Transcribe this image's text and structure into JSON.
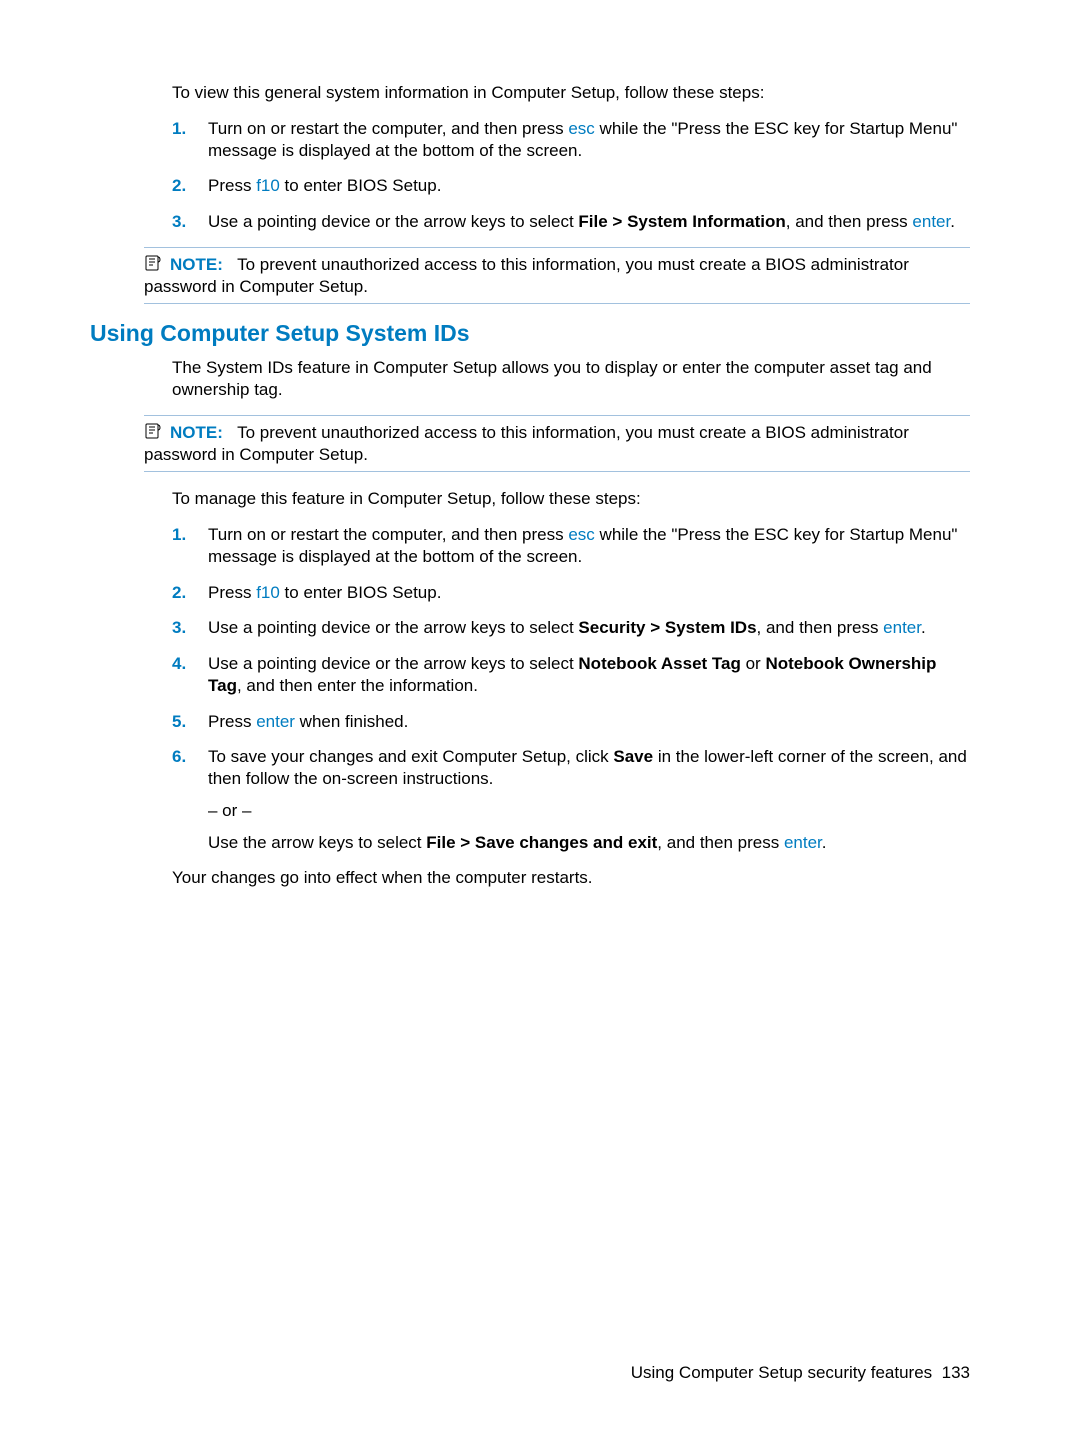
{
  "intro1": "To view this general system information in Computer Setup, follow these steps:",
  "steps1": {
    "s1a": "Turn on or restart the computer, and then press ",
    "s1b_key": "esc",
    "s1c": " while the \"Press the ESC key for Startup Menu\" message is displayed at the bottom of the screen.",
    "s2a": "Press ",
    "s2b_key": "f10",
    "s2c": " to enter BIOS Setup.",
    "s3a": "Use a pointing device or the arrow keys to select ",
    "s3b_bold": "File > System Information",
    "s3c": ", and then press ",
    "s3d_key": "enter",
    "s3e": "."
  },
  "note1": {
    "label": "NOTE:",
    "text": "To prevent unauthorized access to this information, you must create a BIOS administrator password in Computer Setup."
  },
  "heading2": "Using Computer Setup System IDs",
  "para2a": "The System IDs feature in Computer Setup allows you to display or enter the computer asset tag and ownership tag.",
  "note2": {
    "label": "NOTE:",
    "text": "To prevent unauthorized access to this information, you must create a BIOS administrator password in Computer Setup."
  },
  "para2b": "To manage this feature in Computer Setup, follow these steps:",
  "steps2": {
    "s1a": "Turn on or restart the computer, and then press ",
    "s1b_key": "esc",
    "s1c": " while the \"Press the ESC key for Startup Menu\" message is displayed at the bottom of the screen.",
    "s2a": "Press ",
    "s2b_key": "f10",
    "s2c": " to enter BIOS Setup.",
    "s3a": "Use a pointing device or the arrow keys to select ",
    "s3b_bold": "Security > System IDs",
    "s3c": ", and then press ",
    "s3d_key": "enter",
    "s3e": ".",
    "s4a": "Use a pointing device or the arrow keys to select ",
    "s4b_bold": "Notebook Asset Tag",
    "s4c": " or ",
    "s4d_bold": "Notebook Ownership Tag",
    "s4e": ", and then enter the information.",
    "s5a": "Press ",
    "s5b_key": "enter",
    "s5c": " when finished.",
    "s6a": "To save your changes and exit Computer Setup, click ",
    "s6b_bold": "Save",
    "s6c": " in the lower-left corner of the screen, and then follow the on-screen instructions.",
    "or": "– or –",
    "s6d": "Use the arrow keys to select ",
    "s6e_bold": "File > Save changes and exit",
    "s6f": ", and then press ",
    "s6g_key": "enter",
    "s6h": "."
  },
  "closing": "Your changes go into effect when the computer restarts.",
  "footer_text": "Using Computer Setup security features",
  "footer_page": "133"
}
